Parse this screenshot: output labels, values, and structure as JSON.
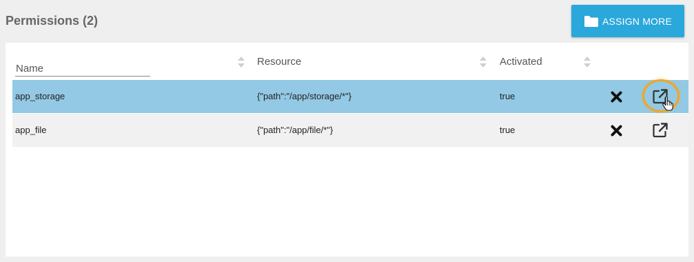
{
  "header": {
    "title": "Permissions (2)",
    "assign_button_label": "ASSIGN MORE",
    "assign_button_icon": "folder-icon"
  },
  "table": {
    "filter_placeholder": "Name",
    "columns": [
      "Name",
      "Resource",
      "Activated"
    ],
    "rows": [
      {
        "name": "app_storage",
        "resource": "{\"path\":\"/app/storage/*\"}",
        "activated": "true",
        "selected": true
      },
      {
        "name": "app_file",
        "resource": "{\"path\":\"/app/file/*\"}",
        "activated": "true",
        "selected": false
      }
    ],
    "row_actions": [
      "delete-icon",
      "open-external-icon"
    ]
  },
  "colors": {
    "accent": "#2aa7db",
    "selected_row": "#93c9e4",
    "highlight": "#f0a526"
  }
}
